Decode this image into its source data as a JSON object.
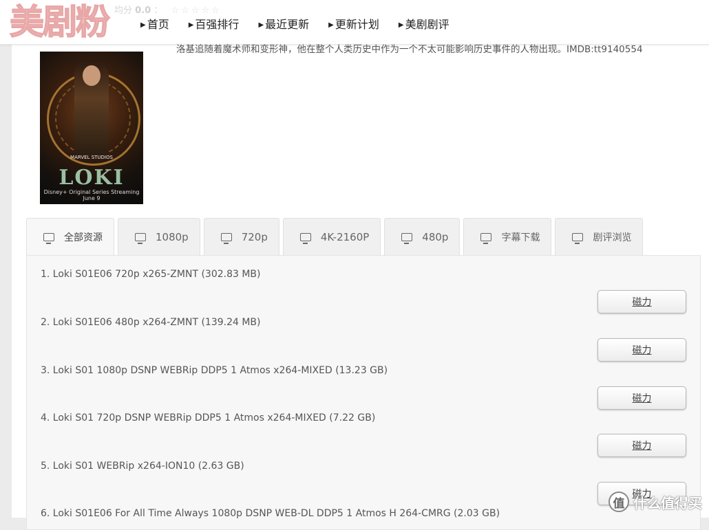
{
  "header": {
    "logo": "美剧粉",
    "rating_prefix": "均分",
    "rating_value": "0.0",
    "rating_sep": "：",
    "rating_stars": "☆☆☆☆☆",
    "nav": [
      {
        "label": "首页"
      },
      {
        "label": "百强排行"
      },
      {
        "label": "最近更新"
      },
      {
        "label": "更新计划"
      },
      {
        "label": "美剧剧评"
      }
    ]
  },
  "show": {
    "description": "洛基追随着魔术师和变形神，他在整个人类历史中作为一个不太可能影响历史事件的人物出现。IMDB:tt9140554",
    "poster": {
      "brand": "MARVEL STUDIOS",
      "title": "LOKI",
      "footer": "Disney+  Original Series Streaming June 9"
    }
  },
  "tabs": [
    {
      "label": "全部资源",
      "active": true
    },
    {
      "label": "1080p"
    },
    {
      "label": "720p"
    },
    {
      "label": "4K-2160P"
    },
    {
      "label": "480p"
    },
    {
      "label": "字幕下载"
    },
    {
      "label": "剧评浏览"
    }
  ],
  "resources": [
    {
      "name": "1. Loki S01E06 720p x265-ZMNT (302.83 MB)",
      "button": "磁力"
    },
    {
      "name": "2. Loki S01E06 480p x264-ZMNT (139.24 MB)",
      "button": "磁力"
    },
    {
      "name": "3. Loki S01 1080p DSNP WEBRip DDP5 1 Atmos x264-MIXED (13.23 GB)",
      "button": "磁力"
    },
    {
      "name": "4. Loki S01 720p DSNP WEBRip DDP5 1 Atmos x264-MIXED (7.22 GB)",
      "button": "磁力"
    },
    {
      "name": "5. Loki S01 WEBRip x264-ION10 (2.63 GB)",
      "button": "磁力"
    },
    {
      "name": "6. Loki S01E06 For All Time Always 1080p DSNP WEB-DL DDP5 1 Atmos H 264-CMRG (2.03 GB)",
      "button": ""
    }
  ],
  "watermark": {
    "icon": "值",
    "text": "什么值得买"
  }
}
